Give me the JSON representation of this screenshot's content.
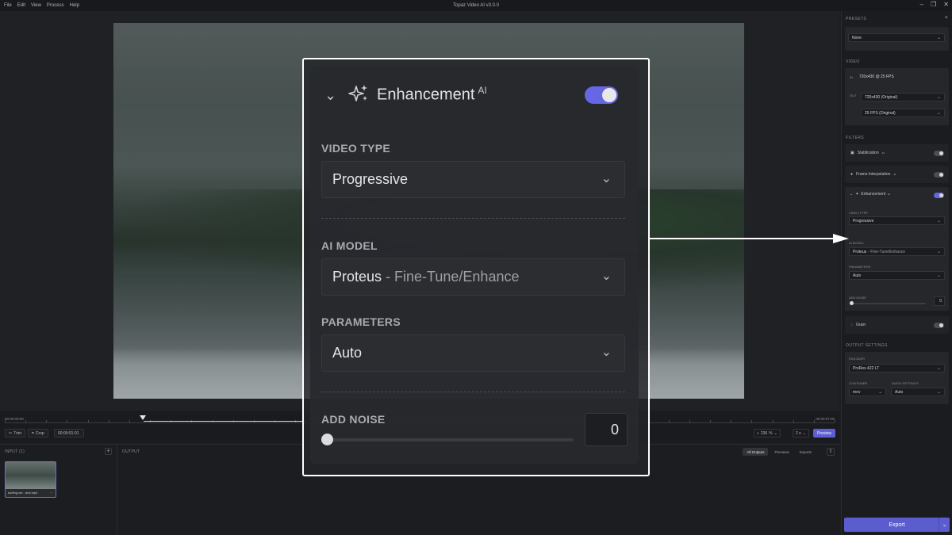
{
  "titlebar": {
    "menu": [
      "File",
      "Edit",
      "View",
      "Process",
      "Help"
    ],
    "title": "Topaz Video AI  v3.0.0",
    "controls": [
      "–",
      "❐",
      "✕"
    ]
  },
  "transport": {
    "timecode_start": "00:00:00:00",
    "timecode_end": "00:00:07:00",
    "trim_label": "Trim",
    "crop_label": "Crop",
    "timecode_field": "00:00:01:01",
    "zoom_value": "236",
    "zoom_unit": "%",
    "speed": "2 x",
    "preview_label": "Preview"
  },
  "input_panel": {
    "label": "INPUT (1)",
    "add": "+",
    "file_name": "surfing cut - dvd.mp4",
    "file_menu": "···"
  },
  "output_panel": {
    "label": "OUTPUT",
    "tabs": [
      "All Outputs",
      "Previews",
      "Exports"
    ],
    "active_tab": "All Outputs"
  },
  "sidebar": {
    "presets_label": "PRESETS",
    "presets_add": "+",
    "preset_value": "None",
    "video_label": "VIDEO",
    "in_tag": "IN",
    "in_value": "720x430 @ 25 FPS",
    "out_tag": "OUT",
    "out_resolution": "720x430 (Original)",
    "out_fps": "25 FPS (Original)",
    "filters_label": "FILTERS",
    "stabilization": "Stabilization",
    "frame_interpolation": "Frame Interpolation",
    "enhancement": "Enhancement",
    "ai_sup": "AI",
    "video_type_label": "VIDEO TYPE",
    "video_type_value": "Progressive",
    "ai_model_label": "AI MODEL",
    "ai_model_value": "Proteus",
    "ai_model_sub": "- Fine-Tune/Enhance",
    "parameters_label": "PARAMETERS",
    "parameters_value": "Auto",
    "add_noise_label": "ADD NOISE",
    "add_noise_value": "0",
    "grain": "Grain",
    "output_settings_label": "OUTPUT SETTINGS",
    "encoder_label": "ENCODER",
    "encoder_value": "ProRes 422 LT",
    "container_label": "CONTAINER",
    "container_value": "mov",
    "audio_label": "AUDIO SETTINGS",
    "audio_value": "Auto",
    "export_label": "Export"
  },
  "callout": {
    "title": "Enhancement",
    "title_sup": "AI",
    "enabled": true,
    "video_type_label": "VIDEO TYPE",
    "video_type_value": "Progressive",
    "ai_model_label": "AI MODEL",
    "ai_model_value": "Proteus",
    "ai_model_sub": "- Fine-Tune/Enhance",
    "parameters_label": "PARAMETERS",
    "parameters_value": "Auto",
    "add_noise_label": "ADD NOISE",
    "add_noise_value": "0",
    "add_noise_level": 0
  },
  "colors": {
    "accent": "#6466e0",
    "background": "#1d1e22",
    "panel": "#26272b",
    "callout_border": "#ffffff"
  }
}
